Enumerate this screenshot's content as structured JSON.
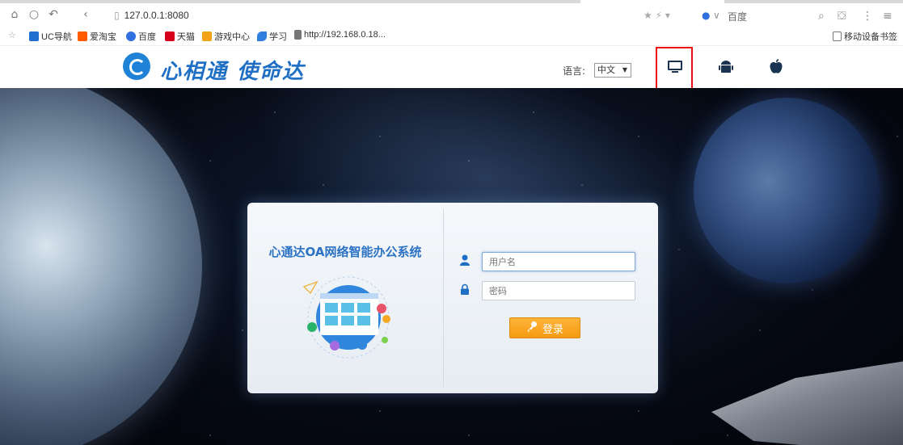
{
  "browser": {
    "url": "127.0.0.1:8080",
    "search_engine": "百度",
    "bookmarks": [
      {
        "label": "UC导航",
        "color": "#1e6fd0"
      },
      {
        "label": "爱淘宝",
        "color": "#ff5a00"
      },
      {
        "label": "百度",
        "color": "#2f6fe0"
      },
      {
        "label": "天猫",
        "color": "#d6001c"
      },
      {
        "label": "游戏中心",
        "color": "#f2a31b"
      },
      {
        "label": "学习",
        "color": "#2f7fe0"
      },
      {
        "label": "http://192.168.0.18...",
        "color": "#777777"
      }
    ],
    "mobile_bookmarks": "移动设备书签"
  },
  "header": {
    "logo_text": "心相通 使命达",
    "lang_label": "语言:",
    "lang_value": "中文",
    "platforms": [
      "desktop-icon",
      "android-icon",
      "apple-icon"
    ]
  },
  "login": {
    "title": "心通达OA网络智能办公系统",
    "username_placeholder": "用户名",
    "password_placeholder": "密码",
    "button_label": "登录"
  },
  "colors": {
    "brand_blue": "#1f6fc4",
    "button_orange": "#f59a11",
    "highlight_red": "#e11111"
  }
}
